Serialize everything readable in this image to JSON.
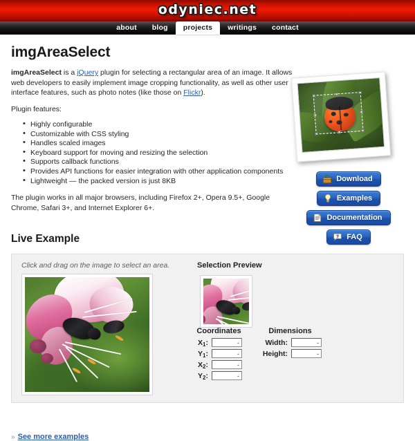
{
  "header": {
    "logo": "odyniec.net",
    "nav": [
      {
        "label": "about",
        "active": false
      },
      {
        "label": "blog",
        "active": false
      },
      {
        "label": "projects",
        "active": true
      },
      {
        "label": "writings",
        "active": false
      },
      {
        "label": "contact",
        "active": false
      }
    ]
  },
  "main": {
    "title": "imgAreaSelect",
    "intro": {
      "lead": "imgAreaSelect",
      "text_1": " is a ",
      "link_jquery": "jQuery",
      "text_2": " plugin for selecting a rectangular area of an image. It allows web developers to easily implement image cropping functionality, as well as other user interface features, such as photo notes (like those on ",
      "link_flickr": "Flickr",
      "text_3": ")."
    },
    "features_heading": "Plugin features:",
    "features": [
      "Highly configurable",
      "Customizable with CSS styling",
      "Handles scaled images",
      "Keyboard support for moving and resizing the selection",
      "Supports callback functions",
      "Provides API functions for easier integration with other application components",
      "Lightweight — the packed version is just 8KB"
    ],
    "browsers": "The plugin works in all major browsers, including Firefox 2+, Opera 9.5+, Google Chrome, Safari 3+, and Internet Explorer 6+."
  },
  "buttons": [
    {
      "label": "Download",
      "icon": "package-icon"
    },
    {
      "label": "Examples",
      "icon": "lightbulb-icon"
    },
    {
      "label": "Documentation",
      "icon": "document-icon"
    },
    {
      "label": "FAQ",
      "icon": "question-bubble-icon"
    }
  ],
  "hero_photo": {
    "alt": "ladybug-photo",
    "selection": "dashed-selection-rectangle"
  },
  "live_example": {
    "heading": "Live Example",
    "hint": "Click and drag on the image to select an area.",
    "image_alt": "flower-with-bee-photo",
    "preview": {
      "label": "Selection Preview",
      "image_alt": "selection-preview-thumbnail"
    },
    "coordinates": {
      "title": "Coordinates",
      "fields": [
        {
          "label": "X",
          "sub": "1",
          "suffix": ":",
          "value": "-"
        },
        {
          "label": "Y",
          "sub": "1",
          "suffix": ":",
          "value": "-"
        },
        {
          "label": "X",
          "sub": "2",
          "suffix": ":",
          "value": "-"
        },
        {
          "label": "Y",
          "sub": "2",
          "suffix": ":",
          "value": "-"
        }
      ]
    },
    "dimensions": {
      "title": "Dimensions",
      "fields": [
        {
          "label": "Width:",
          "value": "-"
        },
        {
          "label": "Height:",
          "value": "-"
        }
      ]
    }
  },
  "footer": {
    "chevron": "»",
    "more_examples": "See more examples"
  },
  "colors": {
    "header_red": "#ee1c06",
    "nav_black": "#111111",
    "link_blue": "#2a5db0",
    "button_blue": "#2a63bd",
    "panel_gray": "#f1f1f1"
  }
}
